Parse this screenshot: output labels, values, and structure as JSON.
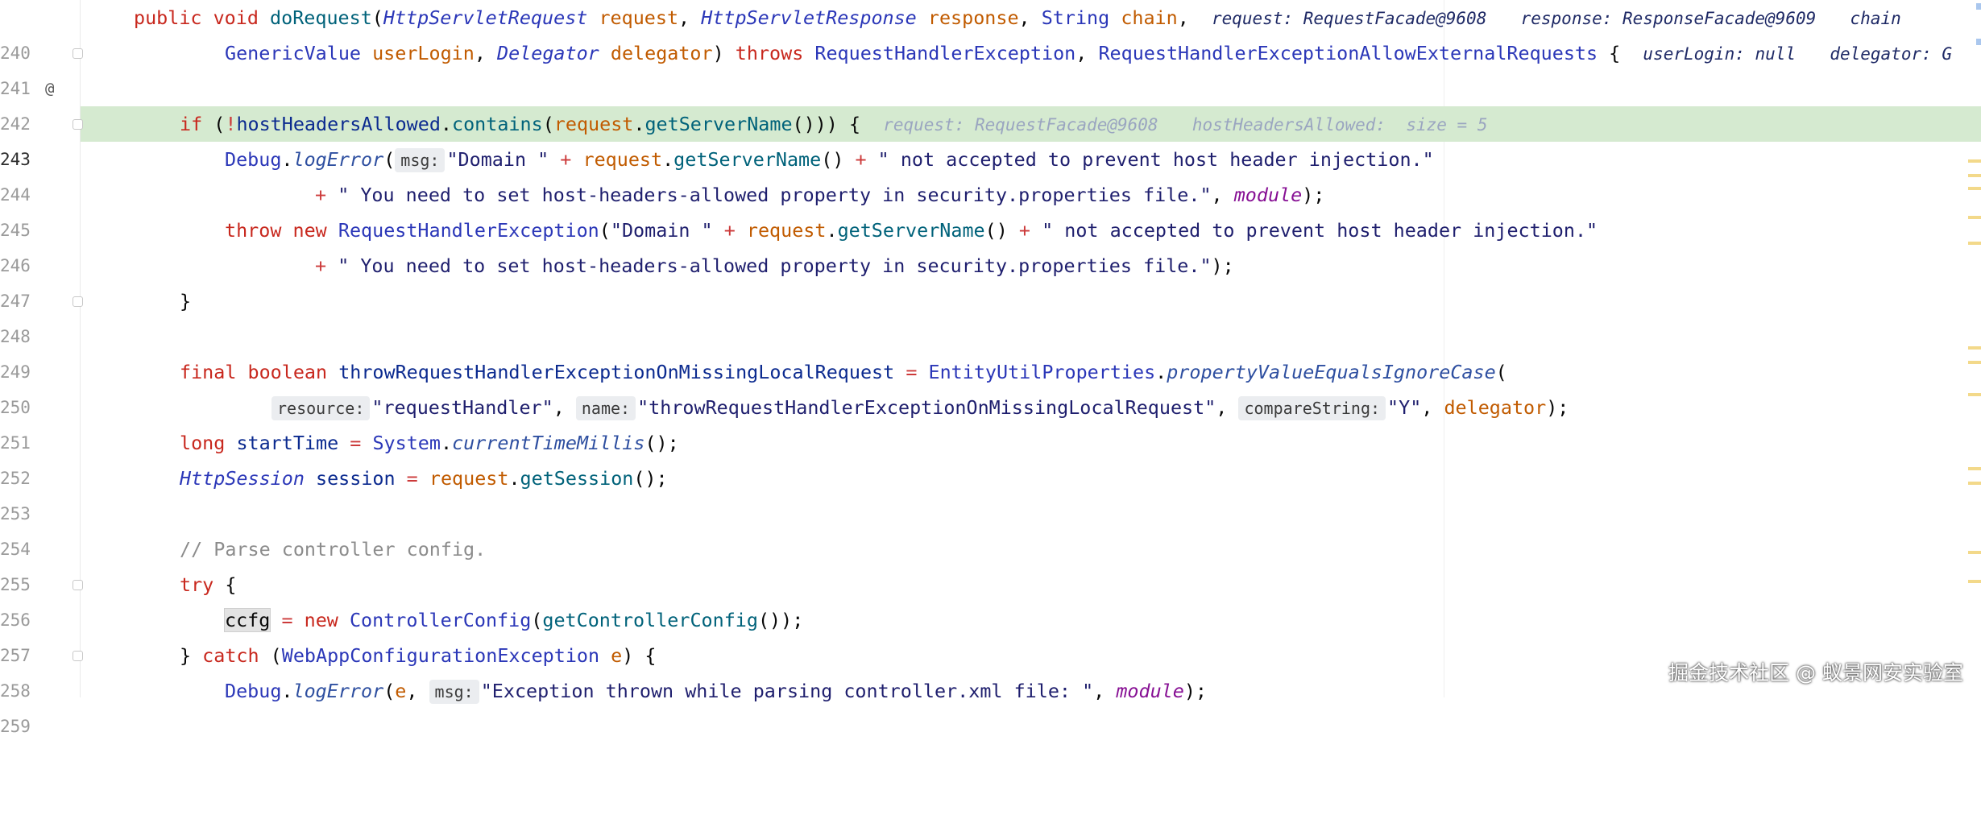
{
  "watermark": "掘金技术社区 @ 蚁景网安实验室",
  "gutter_annotation": "@",
  "line_numbers": [
    "240",
    "241",
    "242",
    "243",
    "244",
    "245",
    "246",
    "247",
    "248",
    "249",
    "250",
    "251",
    "252",
    "253",
    "254",
    "255",
    "256",
    "257",
    "258",
    "259"
  ],
  "code": {
    "l240": {
      "public": "public",
      "void": "void",
      "method": "doRequest",
      "p1type": "HttpServletRequest",
      "p1": "request",
      "p2type": "HttpServletResponse",
      "p2": "response",
      "p3type": "String",
      "p3": "chain",
      "inline1": "request: RequestFacade@9608",
      "inline2": "response: ResponseFacade@9609",
      "inline3": "chain"
    },
    "l241": {
      "p4type": "GenericValue",
      "p4": "userLogin",
      "p5type": "Delegator",
      "p5": "delegator",
      "throws": "throws",
      "ex1": "RequestHandlerException",
      "ex2": "RequestHandlerExceptionAllowExternalRequests",
      "inline1": "userLogin: null",
      "inline2": "delegator: G"
    },
    "l243": {
      "if": "if",
      "field": "hostHeadersAllowed",
      "contains": "contains",
      "req": "request",
      "getServerName": "getServerName",
      "inline1": "request: RequestFacade@9608",
      "inline2": "hostHeadersAllowed:  size = 5"
    },
    "l244": {
      "debug": "Debug",
      "logError": "logError",
      "hint_msg": "msg:",
      "s1": "\"Domain \"",
      "req": "request",
      "getServerName": "getServerName",
      "s2": "\" not accepted to prevent host header injection.\""
    },
    "l245": {
      "s3": "\" You need to set host-headers-allowed property in security.properties file.\"",
      "module": "module"
    },
    "l246": {
      "throw": "throw",
      "new": "new",
      "ex": "RequestHandlerException",
      "s1": "\"Domain \"",
      "req": "request",
      "getServerName": "getServerName",
      "s2": "\" not accepted to prevent host header injection.\""
    },
    "l247": {
      "s3": "\" You need to set host-headers-allowed property in security.properties file.\""
    },
    "l250": {
      "final": "final",
      "boolean": "boolean",
      "var": "throwRequestHandlerExceptionOnMissingLocalRequest",
      "cls": "EntityUtilProperties",
      "method": "propertyValueEqualsIgnoreCase"
    },
    "l251": {
      "hint_resource": "resource:",
      "s_resource": "\"requestHandler\"",
      "hint_name": "name:",
      "s_name": "\"throwRequestHandlerExceptionOnMissingLocalRequest\"",
      "hint_compare": "compareString:",
      "s_compare": "\"Y\"",
      "delegator": "delegator"
    },
    "l252": {
      "long": "long",
      "var": "startTime",
      "cls": "System",
      "method": "currentTimeMillis"
    },
    "l253": {
      "type": "HttpSession",
      "var": "session",
      "req": "request",
      "method": "getSession"
    },
    "l255": {
      "comment": "// Parse controller config."
    },
    "l256": {
      "try": "try"
    },
    "l257": {
      "var": "ccfg",
      "new": "new",
      "cls": "ControllerConfig",
      "method": "getControllerConfig"
    },
    "l258": {
      "catch": "catch",
      "ex": "WebAppConfigurationException",
      "e": "e"
    },
    "l259": {
      "debug": "Debug",
      "logError": "logError",
      "e": "e",
      "hint_msg": "msg:",
      "s1": "\"Exception thrown while parsing controller.xml file: \"",
      "module": "module"
    }
  }
}
